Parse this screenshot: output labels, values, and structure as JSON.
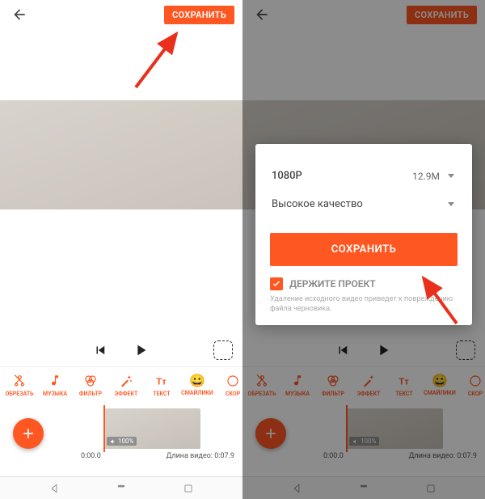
{
  "topbar": {
    "save": "СОХРАНИТЬ"
  },
  "playback": {
    "time_start": "0:00.0",
    "duration_label": "Длина видео: 0:07.9",
    "volume": "100%"
  },
  "tools": [
    {
      "id": "trim",
      "label": "ОБРЕЗАТЬ"
    },
    {
      "id": "music",
      "label": "МУЗЫКА"
    },
    {
      "id": "filter",
      "label": "ФИЛЬТР"
    },
    {
      "id": "effect",
      "label": "ЭФФЕКТ"
    },
    {
      "id": "text",
      "label": "ТЕКСТ"
    },
    {
      "id": "emoji",
      "label": "СМАЙЛИКИ"
    },
    {
      "id": "more",
      "label": "СКОР"
    }
  ],
  "dialog": {
    "resolution": "1080P",
    "size": "12.9M",
    "quality": "Высокое качество",
    "save": "СОХРАНИТЬ",
    "keep": "ДЕРЖИТЕ ПРОЕКТ",
    "note": "Удаление исходного видео приведет к повреждению файла черновика."
  }
}
